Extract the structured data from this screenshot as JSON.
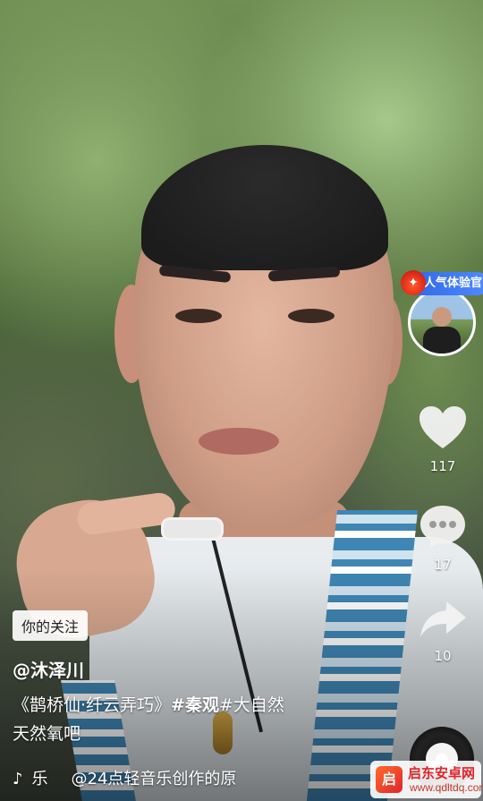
{
  "right_rail": {
    "creator_badge": "人气体验官",
    "like_count": "117",
    "comment_count": "17",
    "share_count": "10"
  },
  "video_info": {
    "follow_tag": "你的关注",
    "author": "@沐泽川",
    "caption_title": "《鹊桥仙·纤云弄巧》",
    "caption_tag1": "#秦观",
    "caption_tag2": "#大自然",
    "caption_line2": "天然氧吧",
    "music_icon": "music-note-icon",
    "music_label": "乐",
    "music_text": "@24点轻音乐创作的原"
  },
  "watermark": {
    "logo_char": "启",
    "title": "启东安卓网",
    "url": "www.qdltdq.com"
  },
  "colors": {
    "badge_blue": "#2f64e6",
    "collar_blue": "#3f86b4",
    "watermark_red": "#e0252b"
  }
}
